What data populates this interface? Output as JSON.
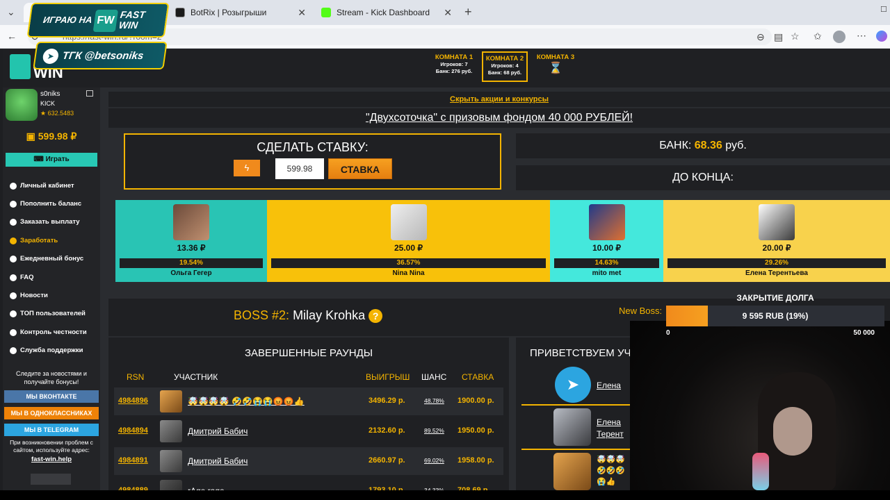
{
  "browser": {
    "tabs": [
      {
        "label": "",
        "active": true
      },
      {
        "label": "BotRix | Розыгрыши",
        "active": false
      },
      {
        "label": "Stream - Kick Dashboard",
        "active": false
      }
    ],
    "url": "https://fast-win.ru/?room=2"
  },
  "overlay": {
    "play_banner": "ИГРАЮ НА",
    "brand": "FAST WIN",
    "tg_banner": "ТГК @betsoniks"
  },
  "site": {
    "logo": "WIN",
    "user": {
      "name": "s0niks",
      "platform": "KICK",
      "rating": "★ 632.5483",
      "balance": "599.98 ₽",
      "play_button": "Играть"
    },
    "menu": [
      "Личный кабинет",
      "Пополнить баланс",
      "Заказать выплату",
      "Заработать",
      "Ежедневный бонус",
      "FAQ",
      "Новости",
      "ТОП пользователей",
      "Контроль честности",
      "Служба поддержки"
    ],
    "follow_text": "Следите за новостями и получайте бонусы!",
    "socials": [
      "МЫ ВКОНТАКТЕ",
      "МЫ В ОДНОКЛАССНИКАХ",
      "МЫ В TELEGRAM"
    ],
    "support_text": "При возникновении проблем с сайтом, используйте адрес:",
    "support_link": "fast-win.help",
    "rooms": [
      {
        "title": "КОМНАТА 1",
        "players": "Игроков: 7",
        "bank": "Банк: 276 руб."
      },
      {
        "title": "КОМНАТА 2",
        "players": "Игроков: 4",
        "bank": "Банк: 68 руб."
      },
      {
        "title": "КОМНАТА 3",
        "players": "",
        "bank": ""
      }
    ],
    "promo_toggle": "Скрыть акции и конкурсы",
    "promo_banner": "\"Двухсоточка\" с призовым фондом 40 000 РУБЛЕЙ!",
    "bet": {
      "title": "СДЕЛАТЬ СТАВКУ:",
      "value": "599.98",
      "button": "СТАВКА"
    },
    "bank": {
      "label": "БАНК:",
      "value": "68.36",
      "unit": "руб."
    },
    "until_end": "ДО КОНЦА:",
    "players": [
      {
        "amount": "13.36 ₽",
        "percent": "19.54%",
        "name": "Ольга Гегер",
        "share": 0.1954,
        "color": "#29c4b4"
      },
      {
        "amount": "25.00 ₽",
        "percent": "36.57%",
        "name": "Nina Nina",
        "share": 0.3657,
        "color": "#f8c10a"
      },
      {
        "amount": "10.00 ₽",
        "percent": "14.63%",
        "name": "mito met",
        "share": 0.1463,
        "color": "#44e8dc"
      },
      {
        "amount": "20.00 ₽",
        "percent": "29.26%",
        "name": "Елена Терентьева",
        "share": 0.2926,
        "color": "#f8d24c"
      }
    ],
    "boss": {
      "label": "BOSS #2:",
      "name": "Milay Krohka",
      "next_label": "New Boss:"
    },
    "rounds": {
      "title": "ЗАВЕРШЕННЫЕ РАУНДЫ",
      "headers": [
        "RSN",
        "УЧАСТНИК",
        "ВЫИГРЫШ",
        "ШАНС",
        "СТАВКА"
      ],
      "rows": [
        {
          "rsn": "4984896",
          "who": "🤯🤯🤯🤯 🤣🤣😭😭😡😡👍",
          "win": "3496.29 р.",
          "chance": "48.78%",
          "stake": "1900.00 р."
        },
        {
          "rsn": "4984894",
          "who": "Дмитрий Бабич",
          "win": "2132.60 р.",
          "chance": "89.52%",
          "stake": "1950.00 р."
        },
        {
          "rsn": "4984891",
          "who": "Дмитрий Бабич",
          "win": "2660.97 р.",
          "chance": "69.02%",
          "stake": "1958.00 р."
        },
        {
          "rsn": "4984889",
          "who": "rAge rage",
          "win": "1793.10 р.",
          "chance": "34.33%",
          "stake": "708.69 р."
        }
      ]
    },
    "welcome": {
      "title": "ПРИВЕТСТВУЕМ УЧ",
      "items": [
        "Елена",
        "Елена Терент",
        "🤯🤯🤯 🤣🤣🤣 😭👍"
      ]
    }
  },
  "stream_widget": {
    "title": "ЗАКРЫТИЕ ДОЛГА",
    "progress_text": "9 595 RUB (19%)",
    "progress": 0.19,
    "min": "0",
    "max": "50 000"
  }
}
